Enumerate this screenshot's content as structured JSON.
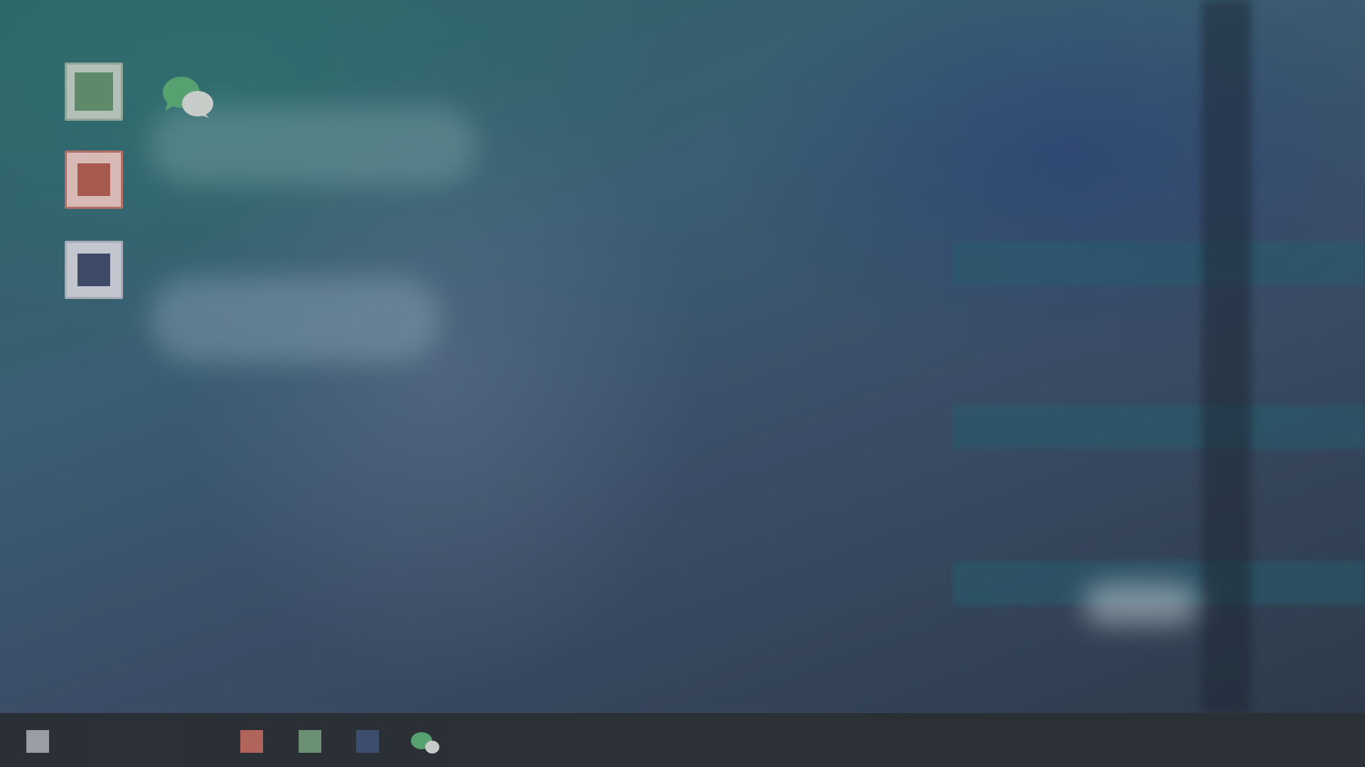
{
  "desktop": {
    "wallpaper": "blurred-anime-artwork",
    "icons": [
      {
        "name": "green-app-icon",
        "color": "#5f8a6a"
      },
      {
        "name": "chat-app-icon",
        "color": "#57a06f"
      },
      {
        "name": "red-app-icon",
        "color": "#a85a4f"
      },
      {
        "name": "navy-app-icon",
        "color": "#3e4a66"
      }
    ]
  },
  "taskbar": {
    "items": [
      {
        "name": "start-icon",
        "color": "#9a9ea4"
      },
      {
        "name": "red-app-icon",
        "color": "#b0645a"
      },
      {
        "name": "green-app-icon",
        "color": "#6a8f73"
      },
      {
        "name": "navy-app-icon",
        "color": "#3c4d6e"
      },
      {
        "name": "chat-app-icon",
        "color": "#57a06f"
      }
    ]
  }
}
